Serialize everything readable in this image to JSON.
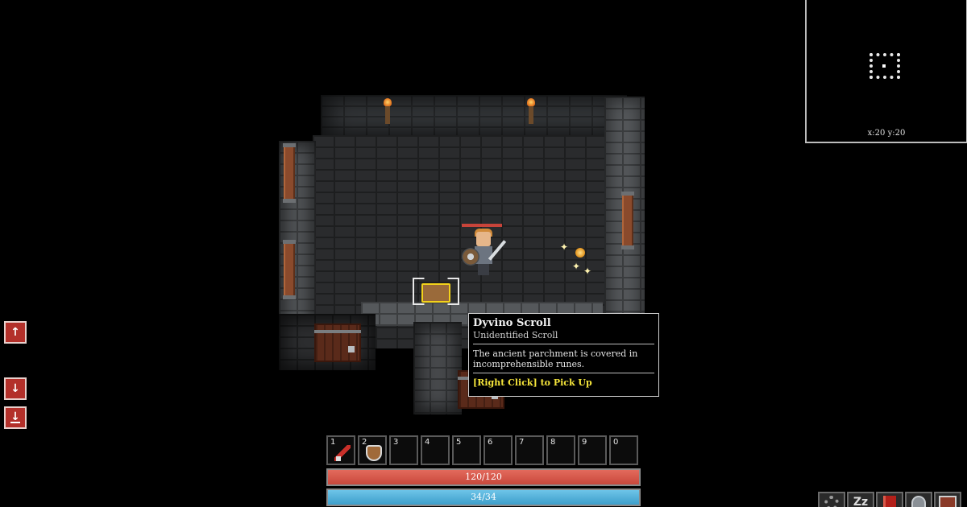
{
  "minimap": {
    "coords": "x:20 y:20"
  },
  "tooltip": {
    "title": "Dyvino Scroll",
    "subtitle": "Unidentified Scroll",
    "description": "The ancient parchment is covered in incomprehensible runes.",
    "action": "[Right Click] to Pick Up"
  },
  "side_buttons": {
    "up_glyph": "↑",
    "down_glyph": "↓",
    "descend_glyph": "↓"
  },
  "hotbar": {
    "slots": [
      {
        "num": "1",
        "item": "sword-icon"
      },
      {
        "num": "2",
        "item": "shield-icon"
      },
      {
        "num": "3"
      },
      {
        "num": "4"
      },
      {
        "num": "5"
      },
      {
        "num": "6"
      },
      {
        "num": "7"
      },
      {
        "num": "8"
      },
      {
        "num": "9"
      },
      {
        "num": "0"
      }
    ]
  },
  "health": {
    "label": "120/120",
    "fraction": 1.0,
    "color": "#c9483c"
  },
  "mana": {
    "label": "34/34",
    "fraction": 1.0,
    "color": "#3d9fcb"
  },
  "menu": {
    "sleep_label": "Zz",
    "items": [
      "settings-gear-icon",
      "sleep-icon",
      "spellbook-icon",
      "equipment-helmet-icon",
      "inventory-chest-icon"
    ]
  }
}
